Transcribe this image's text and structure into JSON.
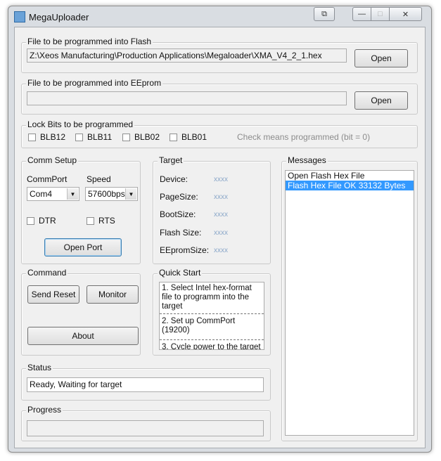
{
  "window": {
    "title": "MegaUploader",
    "controls": {
      "restore_glyph": "⧉",
      "minimize_glyph": "—",
      "maximize_glyph": "□",
      "close_glyph": "✕"
    }
  },
  "flash": {
    "label": "File to be programmed into Flash",
    "path": "Z:\\Xeos Manufacturing\\Production Applications\\Megaloader\\XMA_V4_2_1.hex",
    "open_label": "Open"
  },
  "eeprom": {
    "label": "File to be programmed into EEprom",
    "path": "",
    "open_label": "Open"
  },
  "lock_bits": {
    "label": "Lock Bits to be programmed",
    "items": [
      {
        "label": "BLB12",
        "checked": false
      },
      {
        "label": "BLB11",
        "checked": false
      },
      {
        "label": "BLB02",
        "checked": false
      },
      {
        "label": "BLB01",
        "checked": false
      }
    ],
    "hint": "Check means programmed (bit = 0)"
  },
  "comm_setup": {
    "label": "Comm Setup",
    "commport_label": "CommPort",
    "commport_value": "Com4",
    "speed_label": "Speed",
    "speed_value": "57600bps",
    "dtr_label": "DTR",
    "rts_label": "RTS",
    "open_port_label": "Open Port"
  },
  "target": {
    "label": "Target",
    "rows": [
      {
        "label": "Device:",
        "value": "xxxx"
      },
      {
        "label": "PageSize:",
        "value": "xxxx"
      },
      {
        "label": "BootSize:",
        "value": "xxxx"
      },
      {
        "label": "Flash Size:",
        "value": "xxxx"
      },
      {
        "label": "EEpromSize:",
        "value": "xxxx"
      }
    ]
  },
  "messages": {
    "label": "Messages",
    "items": [
      {
        "text": "Open Flash Hex File",
        "selected": false
      },
      {
        "text": "Flash Hex File OK 33132 Bytes",
        "selected": true
      }
    ]
  },
  "command": {
    "label": "Command",
    "send_reset_label": "Send Reset",
    "monitor_label": "Monitor",
    "about_label": "About"
  },
  "quick_start": {
    "label": "Quick Start",
    "steps": [
      "1. Select Intel hex-format file to programm  into  the target",
      "2. Set up CommPort (19200)",
      "3. Cycle power to the target"
    ]
  },
  "status": {
    "label": "Status",
    "text": "Ready, Waiting for target"
  },
  "progress": {
    "label": "Progress",
    "value": 0
  },
  "colors": {
    "selection": "#3399ff",
    "placeholder_value": "#8aa7c9",
    "window_frame": "#d9dde2",
    "client_bg": "#f0f0f0"
  }
}
